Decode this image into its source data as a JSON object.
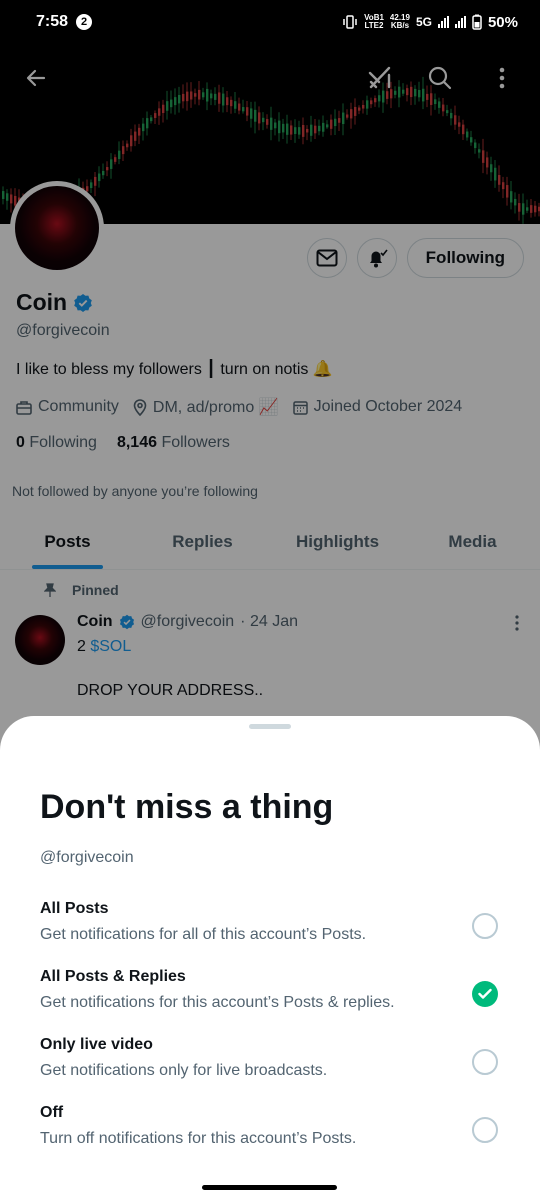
{
  "status_bar": {
    "time": "7:58",
    "notification_count": "2",
    "volte": "VoB1",
    "lte": "LTE2",
    "speed_value": "42.19",
    "speed_unit": "KB/s",
    "network": "5G",
    "battery": "50%"
  },
  "profile": {
    "name": "Coin",
    "handle": "@forgivecoin",
    "bio": "I like to bless my followers ┃ turn on notis 🔔",
    "category": "Community",
    "location": "DM, ad/promo 📈",
    "joined": "Joined October 2024",
    "following_count": "0",
    "following_label": "Following",
    "followers_count": "8,146",
    "followers_label": "Followers",
    "not_followed_text": "Not followed by anyone you’re following",
    "follow_button": "Following"
  },
  "tabs": [
    {
      "label": "Posts",
      "active": true
    },
    {
      "label": "Replies",
      "active": false
    },
    {
      "label": "Highlights",
      "active": false
    },
    {
      "label": "Media",
      "active": false
    }
  ],
  "pinned_post": {
    "pinned_label": "Pinned",
    "author": "Coin",
    "handle": "@forgivecoin",
    "date": "· 24 Jan",
    "line1_prefix": "2",
    "cashtag": "$SOL",
    "line2": "DROP YOUR ADDRESS.."
  },
  "sheet": {
    "title": "Don't miss a thing",
    "handle": "@forgivecoin",
    "options": [
      {
        "title": "All Posts",
        "description": "Get notifications for all of this account’s Posts.",
        "selected": false
      },
      {
        "title": "All Posts & Replies",
        "description": "Get notifications for this account’s Posts & replies.",
        "selected": true
      },
      {
        "title": "Only live video",
        "description": "Get notifications only for live broadcasts.",
        "selected": false
      },
      {
        "title": "Off",
        "description": "Turn off notifications for this account’s Posts.",
        "selected": false
      }
    ]
  },
  "icons": {
    "back": "arrow-left-icon",
    "grok": "grok-icon",
    "search": "search-icon",
    "more": "more-vertical-icon",
    "message": "envelope-icon",
    "bell": "bell-icon",
    "pin": "pin-icon",
    "briefcase": "briefcase-icon",
    "location": "location-icon",
    "calendar": "calendar-icon"
  },
  "colors": {
    "accent": "#1d9bf0",
    "selected": "#00ba7c",
    "text_secondary": "#536471"
  }
}
